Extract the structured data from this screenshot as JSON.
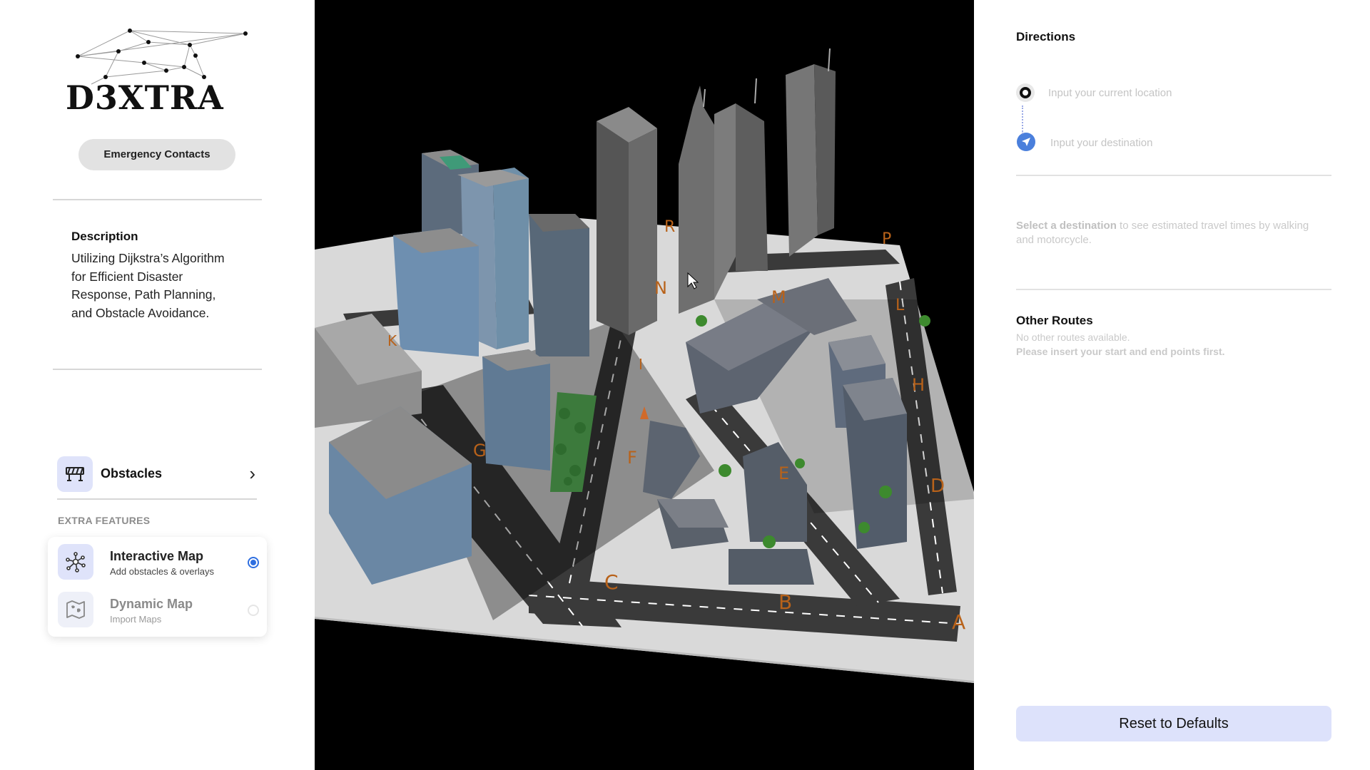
{
  "app": {
    "logo_text": "D3XTRA",
    "emergency_button": "Emergency Contacts"
  },
  "description": {
    "title": "Description",
    "text": "Utilizing Dijkstra’s Algorithm for Efficient Disaster Response, Path Planning, and Obstacle Avoidance."
  },
  "obstacles": {
    "label": "Obstacles",
    "icon": "roadblock-icon"
  },
  "extra_features": {
    "label": "EXTRA FEATURES",
    "items": [
      {
        "title": "Interactive Map",
        "subtitle": "Add obstacles & overlays",
        "icon": "network-icon",
        "selected": true
      },
      {
        "title": "Dynamic Map",
        "subtitle": "Import Maps",
        "icon": "map-icon",
        "selected": false
      }
    ]
  },
  "map": {
    "node_labels": [
      "R",
      "P",
      "N",
      "M",
      "L",
      "K",
      "H",
      "G",
      "F",
      "E",
      "D",
      "C",
      "B",
      "A",
      "I"
    ]
  },
  "directions": {
    "title": "Directions",
    "origin_placeholder": "Input your current location",
    "destination_placeholder": "Input your destination",
    "travel_info_bold": "Select a destination",
    "travel_info_rest": " to see estimated travel times by walking and motorcycle."
  },
  "other_routes": {
    "title": "Other Routes",
    "none_text": "No other routes available.",
    "hint": "Please insert your start and end points first."
  },
  "reset_button": "Reset to Defaults",
  "colors": {
    "accent": "#2f6fe0",
    "accent_soft": "#dde2fb",
    "node_label": "#b8621a"
  }
}
